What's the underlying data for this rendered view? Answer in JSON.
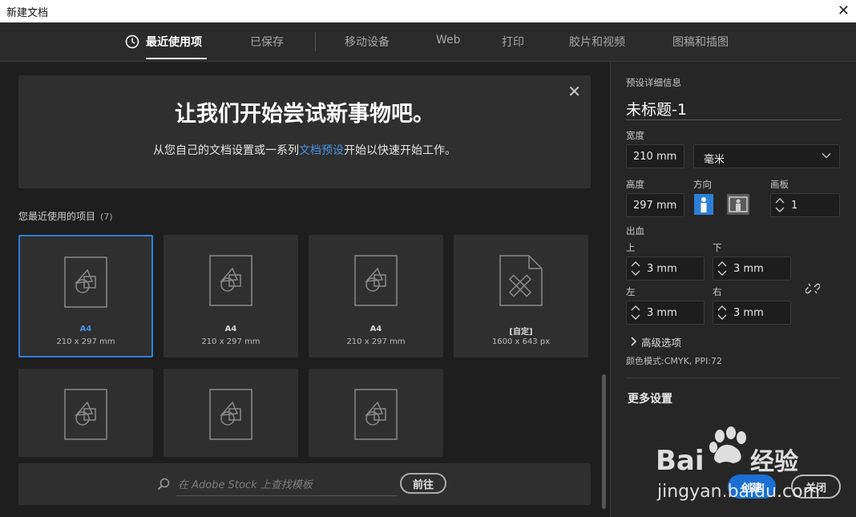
{
  "window": {
    "title": "新建文档"
  },
  "tabs": [
    {
      "label": "最近使用项",
      "active": true
    },
    {
      "label": "已保存"
    },
    {
      "label": "移动设备"
    },
    {
      "label": "Web"
    },
    {
      "label": "打印"
    },
    {
      "label": "胶片和视频"
    },
    {
      "label": "图稿和插图"
    }
  ],
  "banner": {
    "heading": "让我们开始尝试新事物吧。",
    "sub_before": "从您自己的文档设置或一系列",
    "sub_link": "文档预设",
    "sub_after": "开始以快速开始工作。"
  },
  "recent": {
    "label": "您最近使用的项目",
    "count": "(7)",
    "items": [
      {
        "name": "A4",
        "size": "210 x 297 mm",
        "selected": true,
        "icon": "document-shapes-icon"
      },
      {
        "name": "A4",
        "size": "210 x 297 mm",
        "icon": "document-shapes-icon"
      },
      {
        "name": "A4",
        "size": "210 x 297 mm",
        "icon": "document-shapes-icon"
      },
      {
        "name": "[自定]",
        "size": "1600 x 643 px",
        "icon": "document-ruler-pencil-icon"
      },
      {
        "name": "",
        "size": "",
        "icon": "document-shapes-icon"
      },
      {
        "name": "",
        "size": "",
        "icon": "document-shapes-icon"
      },
      {
        "name": "",
        "size": "",
        "icon": "document-shapes-icon"
      }
    ]
  },
  "stock": {
    "placeholder": "在 Adobe Stock 上查找模板",
    "go_label": "前往"
  },
  "preset": {
    "section_label": "预设详细信息",
    "doc_name": "未标题-1",
    "width_label": "宽度",
    "width_value": "210 mm",
    "unit_value": "毫米",
    "height_label": "高度",
    "height_value": "297 mm",
    "orientation_label": "方向",
    "artboards_label": "画板",
    "artboards_value": "1",
    "bleed_label": "出血",
    "top_label": "上",
    "top_value": "3 mm",
    "bottom_label": "下",
    "bottom_value": "3 mm",
    "left_label": "左",
    "left_value": "3 mm",
    "right_label": "右",
    "right_value": "3 mm",
    "advanced_label": "高级选项",
    "color_mode": "颜色模式:CMYK, PPI:72",
    "more_settings": "更多设置"
  },
  "buttons": {
    "create": "创建",
    "close": "关闭"
  },
  "colors": {
    "accent": "#2d7fd6",
    "link": "#4a90e2"
  }
}
